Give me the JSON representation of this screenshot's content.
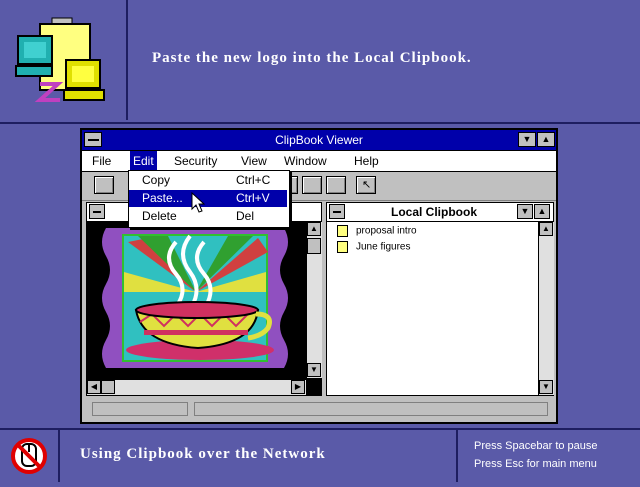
{
  "banner": {
    "instruction": "Paste the new logo into the Local Clipbook.",
    "icon": "network-computers-icon"
  },
  "window": {
    "title": "ClipBook Viewer",
    "menu": [
      "File",
      "Edit",
      "Security",
      "View",
      "Window",
      "Help"
    ],
    "edit_menu": [
      {
        "label": "Copy",
        "shortcut": "Ctrl+C"
      },
      {
        "label": "Paste...",
        "shortcut": "Ctrl+V"
      },
      {
        "label": "Delete",
        "shortcut": "Del"
      }
    ],
    "local_clipbook": {
      "title": "Local Clipbook",
      "items": [
        "proposal intro",
        "June figures"
      ]
    }
  },
  "footer": {
    "title": "Using Clipbook over the Network",
    "help_line1": "Press Spacebar to pause",
    "help_line2": "Press Esc for main menu",
    "icon": "no-mouse-icon"
  },
  "colors": {
    "accent": "#0000aa",
    "background": "#5a5aa8"
  }
}
